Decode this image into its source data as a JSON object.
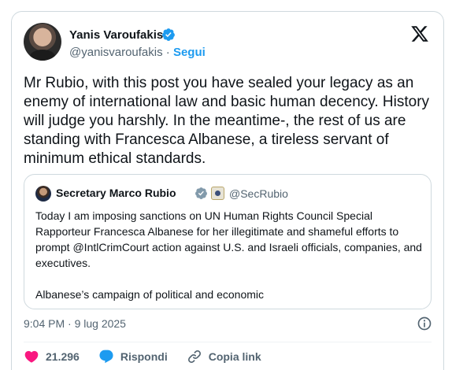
{
  "author": {
    "name": "Yanis Varoufakis",
    "handle": "@yanisvaroufakis",
    "separator": "·",
    "follow_label": "Segui"
  },
  "tweet": {
    "text": "Mr Rubio, with this post you have sealed your legacy as an enemy of international law and basic human decency. History will judge you harshly. In the meantime-, the rest of us are standing with Francesca Albanese, a tireless servant of minimum ethical standards."
  },
  "quote": {
    "name": "Secretary Marco Rubio",
    "handle": "@SecRubio",
    "paragraph1": "Today I am imposing sanctions on UN Human Rights Council Special Rapporteur Francesca Albanese for her illegitimate and shameful efforts to prompt @IntlCrimCourt action against U.S. and Israeli officials, companies, and executives.",
    "paragraph2": "Albanese’s campaign of political and economic"
  },
  "meta": {
    "timestamp": "9:04 PM · 9 lug 2025"
  },
  "actions": {
    "likes": "21.296",
    "reply_label": "Rispondi",
    "copy_link_label": "Copia link"
  },
  "colors": {
    "accent": "#1d9bf0",
    "like": "#f91880",
    "text": "#0f1419",
    "muted": "#536471",
    "border": "#cfd9de"
  },
  "icons": [
    "verified-badge-icon",
    "x-logo-icon",
    "government-seal-icon",
    "info-icon",
    "heart-icon",
    "reply-bubble-icon",
    "link-icon"
  ]
}
